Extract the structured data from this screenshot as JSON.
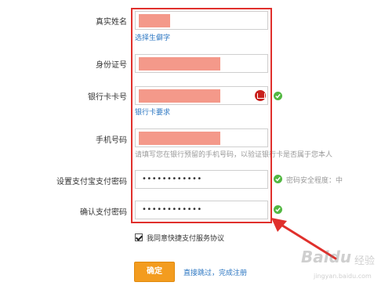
{
  "form": {
    "name_label": "真实姓名",
    "name_link": "选择生僻字",
    "id_label": "身份证号",
    "card_label": "银行卡卡号",
    "card_link": "银行卡要求",
    "phone_label": "手机号码",
    "phone_hint": "请填写您在银行预留的手机号码，以验证银行卡是否属于您本人",
    "pwd_label": "设置支付宝支付密码",
    "pwd_value": "••••••••••••",
    "pwd_strength": "密码安全程度：中",
    "confirm_label": "确认支付密码",
    "confirm_value": "••••••••••••"
  },
  "agreement": {
    "checked": true,
    "text": "我同意快捷支付服务协议"
  },
  "actions": {
    "confirm_label": "确定",
    "skip_label": "直接跳过，完成注册"
  },
  "watermark": {
    "brand": "Baidu",
    "sub": "经验",
    "url": "jingyan.baidu.com"
  },
  "colors": {
    "highlight": "#e0302c",
    "ok": "#53b842",
    "button": "#f39c1f",
    "link": "#2b76c2",
    "redaction": "#f4998a"
  }
}
